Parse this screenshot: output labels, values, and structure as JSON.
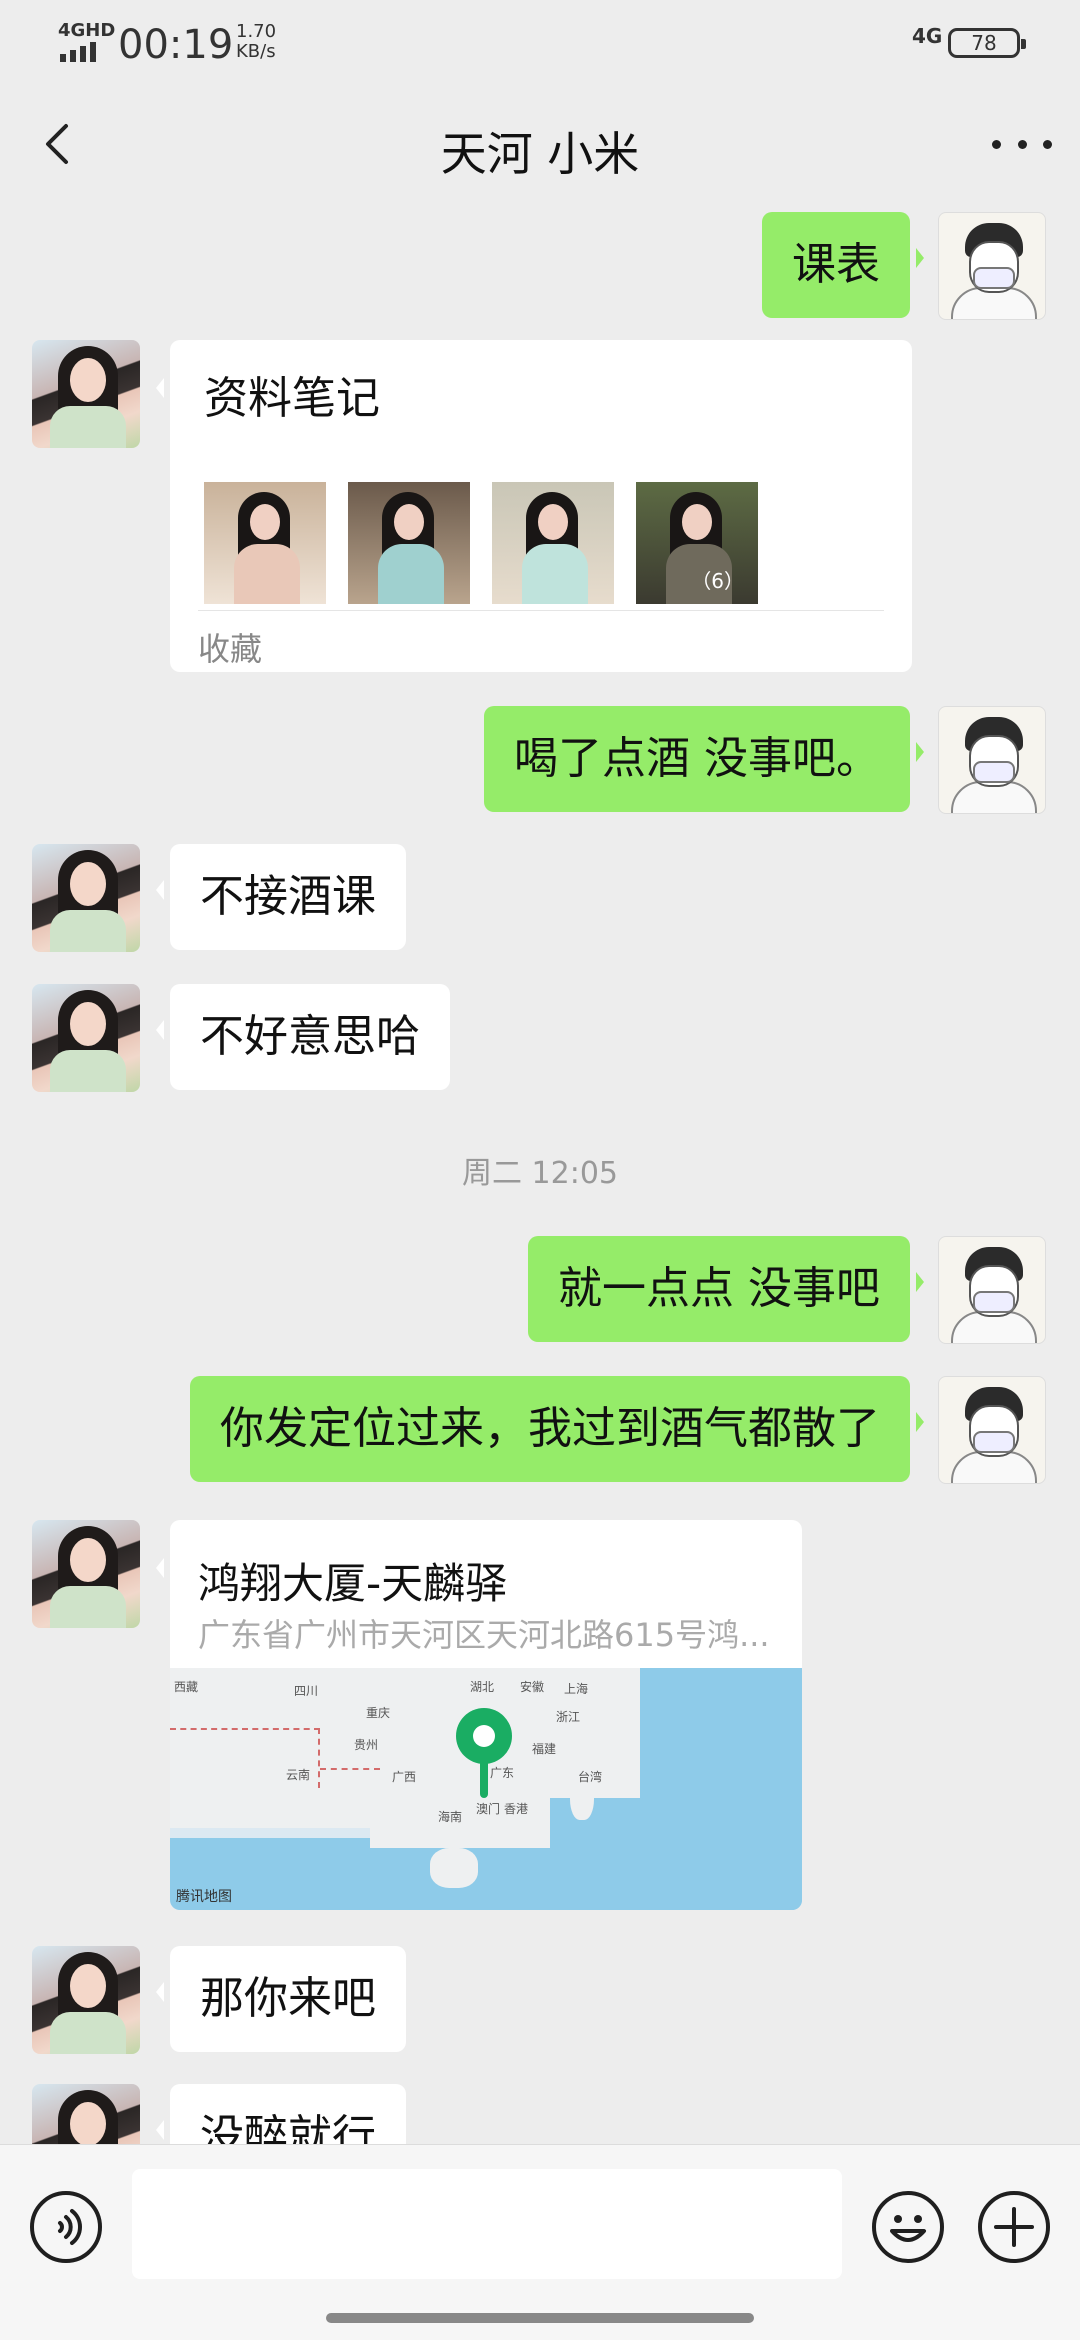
{
  "status_bar": {
    "network": "4GHD",
    "time": "00:19",
    "speed_value": "1.70",
    "speed_unit": "KB/s",
    "cell_type": "4G",
    "battery": "78"
  },
  "header": {
    "title": "天河 小米",
    "back_icon": "chevron-left-icon",
    "more_icon": "more-dots-icon"
  },
  "messages": [
    {
      "from": "me",
      "type": "text",
      "text": "课表"
    },
    {
      "from": "her",
      "type": "notes",
      "title": "资料笔记",
      "image_count_label": "（6）",
      "source": "收藏"
    },
    {
      "from": "me",
      "type": "text",
      "text": "喝了点酒 没事吧。"
    },
    {
      "from": "her",
      "type": "text",
      "text": "不接酒课"
    },
    {
      "from": "her",
      "type": "text",
      "text": "不好意思哈"
    },
    {
      "type": "time",
      "text": "周二 12:05"
    },
    {
      "from": "me",
      "type": "text",
      "text": "就一点点 没事吧"
    },
    {
      "from": "me",
      "type": "text",
      "text": "你发定位过来，我过到酒气都散了"
    },
    {
      "from": "her",
      "type": "location",
      "name": "鸿翔大厦-天麟驿",
      "address": "广东省广州市天河区天河北路615号鸿...",
      "map_credit": "腾讯地图"
    },
    {
      "from": "her",
      "type": "text",
      "text": "那你来吧"
    },
    {
      "from": "her",
      "type": "text",
      "text": "没醉就行"
    }
  ],
  "map_labels": {
    "xizang": "西藏",
    "sichuan": "四川",
    "chongqing": "重庆",
    "hubei": "湖北",
    "anhui": "安徽",
    "shanghai": "上海",
    "zhejiang": "浙江",
    "guizhou": "贵州",
    "yunnan": "云南",
    "guangxi": "广西",
    "fujian": "福建",
    "guangdong": "广东",
    "taiwan": "台湾",
    "aomen": "澳门",
    "xianggang": "香港",
    "hainan": "海南"
  },
  "input_bar": {
    "voice_icon": "voice-icon",
    "emoji_icon": "emoji-icon",
    "plus_icon": "plus-icon",
    "input_value": ""
  },
  "colors": {
    "background": "#ededed",
    "outgoing_bubble": "#95ec69",
    "incoming_bubble": "#ffffff",
    "pin": "#1aad63"
  }
}
